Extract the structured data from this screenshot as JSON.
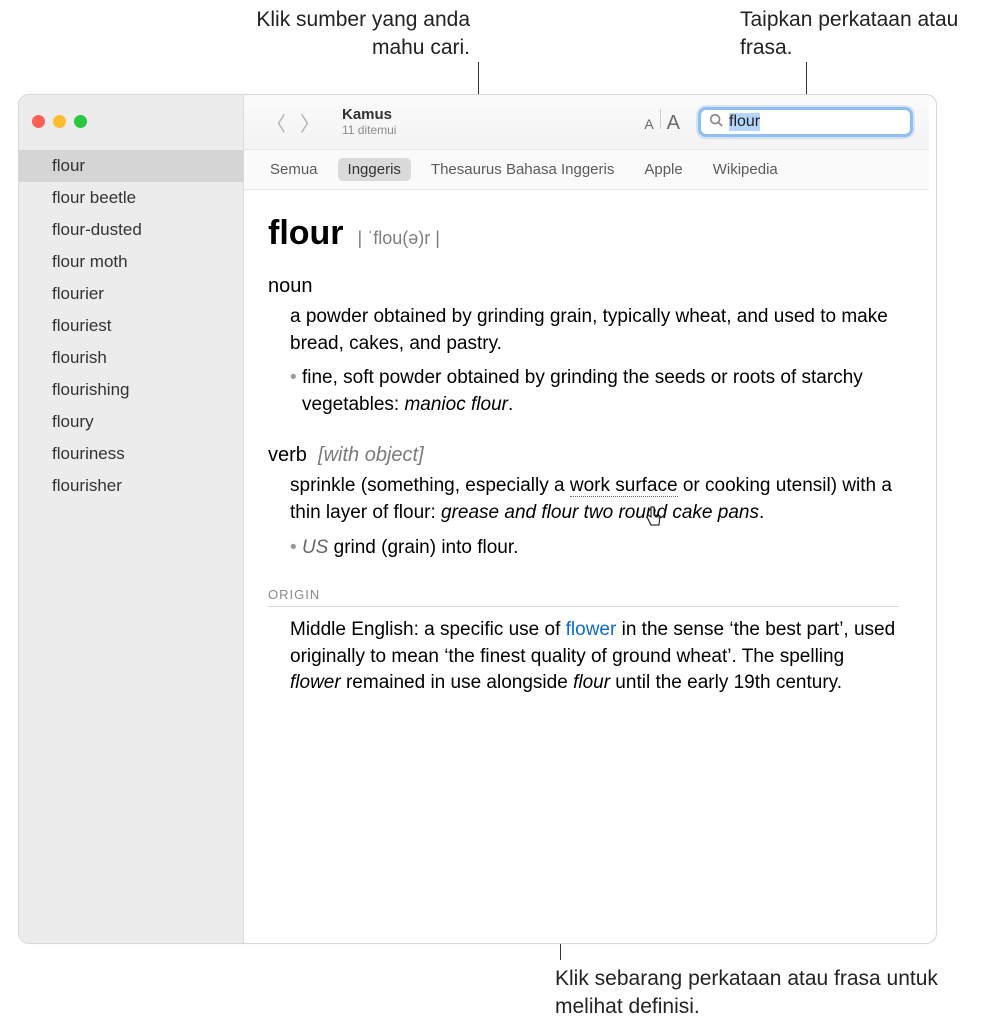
{
  "callouts": {
    "top_left": "Klik sumber yang anda mahu cari.",
    "top_right": "Taipkan perkataan atau frasa.",
    "bottom": "Klik sebarang perkataan atau frasa untuk melihat definisi."
  },
  "toolbar": {
    "title": "Kamus",
    "subtitle": "11 ditemui",
    "font_small": "A",
    "font_big": "A",
    "search_value": "flour"
  },
  "tabs": {
    "items": [
      "Semua",
      "Inggeris",
      "Thesaurus Bahasa Inggeris",
      "Apple",
      "Wikipedia"
    ],
    "active_index": 1
  },
  "sidebar": {
    "items": [
      "flour",
      "flour beetle",
      "flour-dusted",
      "flour moth",
      "flourier",
      "flouriest",
      "flourish",
      "flourishing",
      "floury",
      "flouriness",
      "flourisher"
    ],
    "selected_index": 0
  },
  "entry": {
    "headword": "flour",
    "pronunciation": "| ˈflou(ə)r |",
    "noun_label": "noun",
    "noun_def": "a powder obtained by grinding grain, typically wheat, and used to make bread, cakes, and pastry.",
    "noun_sub_prefix": "fine, soft powder obtained by grinding the seeds or roots of starchy vegetables: ",
    "noun_sub_example": "manioc flour",
    "noun_sub_suffix": ".",
    "verb_label": "verb",
    "verb_gram": "[with object]",
    "verb_def_prefix": "sprinkle (something, especially a ",
    "verb_def_link": "work surface",
    "verb_def_mid": " or cooking utensil) with a thin layer of flour: ",
    "verb_def_example": "grease and flour two round cake pans",
    "verb_def_suffix": ".",
    "verb_sub_region": "US",
    "verb_sub_text": " grind (grain) into flour.",
    "origin_label": "ORIGIN",
    "origin_prefix": "Middle English: a specific use of ",
    "origin_link": "flower",
    "origin_mid": " in the sense ‘the best part’, used originally to mean ‘the finest quality of ground wheat’. The spelling ",
    "origin_italic1": "flower",
    "origin_mid2": " remained in use alongside ",
    "origin_italic2": "flour",
    "origin_suffix": " until the early 19th century."
  }
}
